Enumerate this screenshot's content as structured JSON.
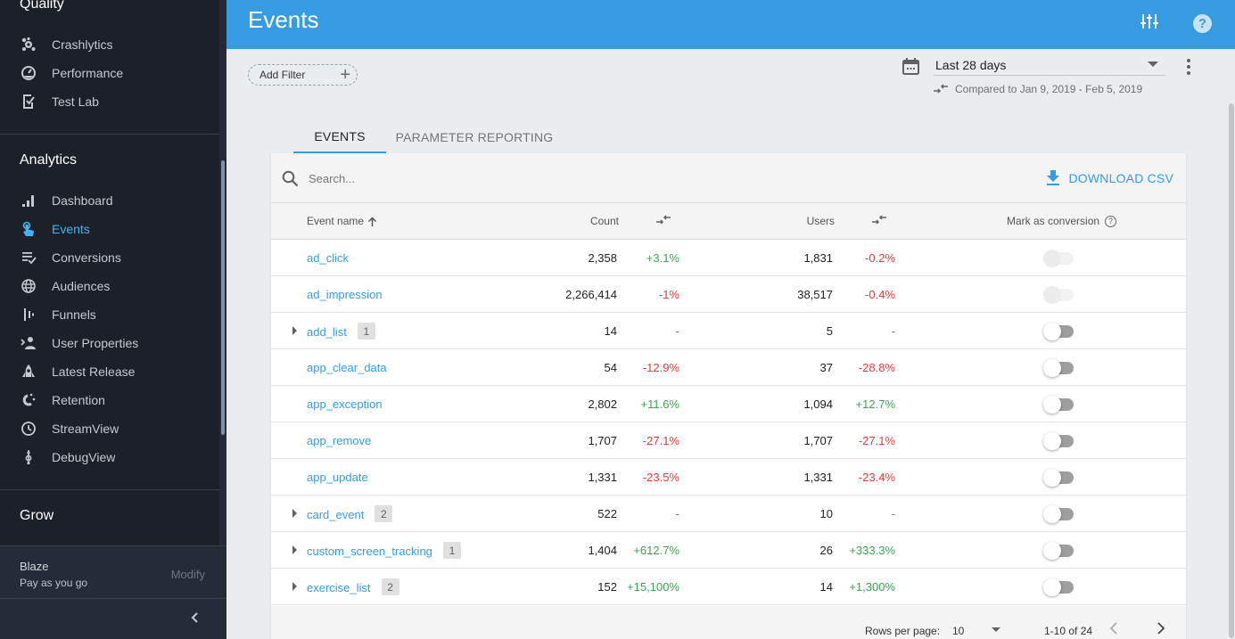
{
  "sidebar": {
    "sections": {
      "quality": "Quality",
      "analytics": "Analytics",
      "grow": "Grow"
    },
    "quality_items": [
      {
        "label": "Crashlytics",
        "icon": "crashlytics-icon"
      },
      {
        "label": "Performance",
        "icon": "performance-icon"
      },
      {
        "label": "Test Lab",
        "icon": "test-lab-icon"
      }
    ],
    "analytics_items": [
      {
        "label": "Dashboard",
        "icon": "dashboard-icon"
      },
      {
        "label": "Events",
        "icon": "touch-icon",
        "active": true
      },
      {
        "label": "Conversions",
        "icon": "conversions-icon"
      },
      {
        "label": "Audiences",
        "icon": "globe-icon"
      },
      {
        "label": "Funnels",
        "icon": "funnels-icon"
      },
      {
        "label": "User Properties",
        "icon": "user-properties-icon"
      },
      {
        "label": "Latest Release",
        "icon": "rocket-icon"
      },
      {
        "label": "Retention",
        "icon": "magnet-icon"
      },
      {
        "label": "StreamView",
        "icon": "clock-icon"
      },
      {
        "label": "DebugView",
        "icon": "debug-icon"
      }
    ],
    "plan": {
      "name": "Blaze",
      "subtitle": "Pay as you go",
      "modify": "Modify"
    }
  },
  "header": {
    "title": "Events"
  },
  "filters": {
    "add_filter": "Add Filter",
    "date_range": "Last 28 days",
    "compared_to": "Compared to Jan 9, 2019 - Feb 5, 2019"
  },
  "tabs": [
    {
      "label": "EVENTS",
      "active": true
    },
    {
      "label": "PARAMETER REPORTING",
      "active": false
    }
  ],
  "toolbar": {
    "search_placeholder": "Search...",
    "download_label": "DOWNLOAD CSV"
  },
  "table": {
    "headers": {
      "name": "Event name",
      "count": "Count",
      "users": "Users",
      "conversion": "Mark as conversion"
    },
    "rows": [
      {
        "name": "ad_click",
        "expandable": false,
        "params": "",
        "count": "2,358",
        "count_change": "+3.1%",
        "count_trend": "pos",
        "users": "1,831",
        "users_change": "-0.2%",
        "users_trend": "neg",
        "conversion": false,
        "conversion_disabled": true
      },
      {
        "name": "ad_impression",
        "expandable": false,
        "params": "",
        "count": "2,266,414",
        "count_change": "-1%",
        "count_trend": "neg",
        "users": "38,517",
        "users_change": "-0.4%",
        "users_trend": "neg",
        "conversion": false,
        "conversion_disabled": true
      },
      {
        "name": "add_list",
        "expandable": true,
        "params": "1",
        "count": "14",
        "count_change": "-",
        "count_trend": "neu",
        "users": "5",
        "users_change": "-",
        "users_trend": "neu",
        "conversion": false,
        "conversion_disabled": false
      },
      {
        "name": "app_clear_data",
        "expandable": false,
        "params": "",
        "count": "54",
        "count_change": "-12.9%",
        "count_trend": "neg",
        "users": "37",
        "users_change": "-28.8%",
        "users_trend": "neg",
        "conversion": false,
        "conversion_disabled": false
      },
      {
        "name": "app_exception",
        "expandable": false,
        "params": "",
        "count": "2,802",
        "count_change": "+11.6%",
        "count_trend": "pos",
        "users": "1,094",
        "users_change": "+12.7%",
        "users_trend": "pos",
        "conversion": false,
        "conversion_disabled": false
      },
      {
        "name": "app_remove",
        "expandable": false,
        "params": "",
        "count": "1,707",
        "count_change": "-27.1%",
        "count_trend": "neg",
        "users": "1,707",
        "users_change": "-27.1%",
        "users_trend": "neg",
        "conversion": false,
        "conversion_disabled": false
      },
      {
        "name": "app_update",
        "expandable": false,
        "params": "",
        "count": "1,331",
        "count_change": "-23.5%",
        "count_trend": "neg",
        "users": "1,331",
        "users_change": "-23.4%",
        "users_trend": "neg",
        "conversion": false,
        "conversion_disabled": false
      },
      {
        "name": "card_event",
        "expandable": true,
        "params": "2",
        "count": "522",
        "count_change": "-",
        "count_trend": "neu",
        "users": "10",
        "users_change": "-",
        "users_trend": "neu",
        "conversion": false,
        "conversion_disabled": false
      },
      {
        "name": "custom_screen_tracking",
        "expandable": true,
        "params": "1",
        "count": "1,404",
        "count_change": "+612.7%",
        "count_trend": "pos",
        "users": "26",
        "users_change": "+333.3%",
        "users_trend": "pos",
        "conversion": false,
        "conversion_disabled": false
      },
      {
        "name": "exercise_list",
        "expandable": true,
        "params": "2",
        "count": "152",
        "count_change": "+15,100%",
        "count_trend": "pos",
        "users": "14",
        "users_change": "+1,300%",
        "users_trend": "pos",
        "conversion": false,
        "conversion_disabled": false
      }
    ]
  },
  "pagination": {
    "rows_per_page_label": "Rows per page:",
    "rows_per_page": "10",
    "range": "1-10 of 24"
  },
  "colors": {
    "accent": "#359ce2",
    "positive": "#3aa354",
    "negative": "#df3d3d",
    "sidebar_bg": "#1c2029",
    "active_nav": "#40b3f4"
  }
}
